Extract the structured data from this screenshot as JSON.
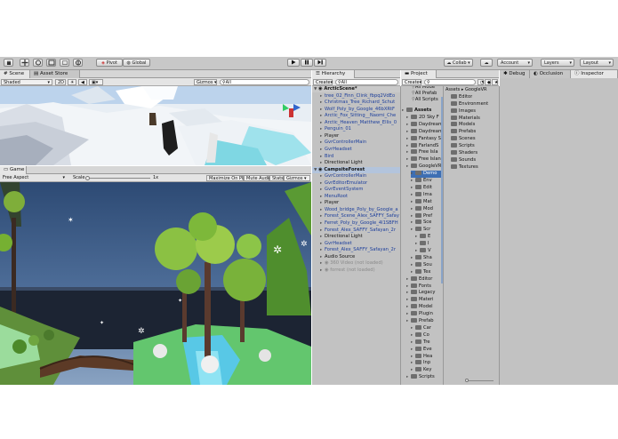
{
  "toolbar": {
    "pivot": "Pivot",
    "global": "Global",
    "collab": "Collab",
    "account": "Account",
    "layers": "Layers",
    "layout": "Layout"
  },
  "scene": {
    "tab": "Scene",
    "tab2": "Asset Store",
    "shading": "Shaded",
    "mode2d": "2D",
    "gizmos": "Gizmos",
    "search": "All"
  },
  "game": {
    "tab": "Game",
    "aspect": "Free Aspect",
    "scale_label": "Scale",
    "scale_value": "1x",
    "maximize": "Maximize On Play",
    "mute": "Mute Audio",
    "stats": "Stats",
    "gizmos": "Gizmos"
  },
  "hierarchy": {
    "tab": "Hierarchy",
    "create": "Create",
    "search": "All",
    "rows": [
      {
        "text": "ArcticScene*",
        "kind": "scene"
      },
      {
        "text": "tree_02_Finn_Clink_fbpq2VdEo",
        "kind": "blue"
      },
      {
        "text": "Christmas_Tree_Richard_Schut",
        "kind": "blue"
      },
      {
        "text": "Wolf_Poly_by_Google_46bXRtF",
        "kind": "blue"
      },
      {
        "text": "Arctic_Fox_Sitting__Naomi_Che",
        "kind": "blue"
      },
      {
        "text": "Arctic_Heaven_Matthew_Ellis_0",
        "kind": "blue"
      },
      {
        "text": "Penguin_01",
        "kind": "blue"
      },
      {
        "text": "Player",
        "kind": "normal"
      },
      {
        "text": "GvrControllerMain",
        "kind": "blue"
      },
      {
        "text": "GvrHeadset",
        "kind": "blue"
      },
      {
        "text": "Bird",
        "kind": "blue"
      },
      {
        "text": "Directional Light",
        "kind": "normal"
      },
      {
        "text": "CampsiteForest",
        "kind": "selected"
      },
      {
        "text": "GvrControllerMain",
        "kind": "blue"
      },
      {
        "text": "GvrEditorEmulator",
        "kind": "blue"
      },
      {
        "text": "GvrEventSystem",
        "kind": "blue"
      },
      {
        "text": "MenuRoot",
        "kind": "blue"
      },
      {
        "text": "Player",
        "kind": "normal"
      },
      {
        "text": "Wood_bridge_Poly_by_Google_a",
        "kind": "blue"
      },
      {
        "text": "Forest_Scene_Alex_SAFFY_Safay",
        "kind": "blue"
      },
      {
        "text": "Ferret_Poly_by_Google_4l1SBFH",
        "kind": "blue"
      },
      {
        "text": "Forest_Alex_SAFFY_Safayan_2r",
        "kind": "blue"
      },
      {
        "text": "Directional Light",
        "kind": "normal"
      },
      {
        "text": "GvrHeadset",
        "kind": "blue"
      },
      {
        "text": "Forest_Alex_SAFFY_Safayan_2r",
        "kind": "blue"
      },
      {
        "text": "Audio Source",
        "kind": "normal"
      },
      {
        "text": "360 Video (not loaded)",
        "kind": "grey"
      },
      {
        "text": "forrest (not loaded)",
        "kind": "grey"
      }
    ]
  },
  "project": {
    "tab": "Project",
    "create": "Create",
    "favorites": [
      "All Mode",
      "All Prefab",
      "All Scripts"
    ],
    "tree": [
      {
        "text": "Assets",
        "depth": 0
      },
      {
        "text": "2D Sky F",
        "depth": 1
      },
      {
        "text": "Daydream",
        "depth": 1
      },
      {
        "text": "Daydream",
        "depth": 1
      },
      {
        "text": "Fantasy S",
        "depth": 1
      },
      {
        "text": "FarlandS",
        "depth": 1
      },
      {
        "text": "Free Isla",
        "depth": 1
      },
      {
        "text": "Free Islan",
        "depth": 1
      },
      {
        "text": "GoogleVR",
        "depth": 1
      },
      {
        "text": "Demo",
        "depth": 2
      },
      {
        "text": "Env",
        "depth": 2
      },
      {
        "text": "Edit",
        "depth": 2
      },
      {
        "text": "Ima",
        "depth": 2
      },
      {
        "text": "Mat",
        "depth": 2
      },
      {
        "text": "Mod",
        "depth": 2
      },
      {
        "text": "Pref",
        "depth": 2
      },
      {
        "text": "Sce",
        "depth": 2
      },
      {
        "text": "Scr",
        "depth": 2
      },
      {
        "text": "E",
        "depth": 3
      },
      {
        "text": "I",
        "depth": 3
      },
      {
        "text": "V",
        "depth": 3
      },
      {
        "text": "Sha",
        "depth": 2
      },
      {
        "text": "Sou",
        "depth": 2
      },
      {
        "text": "Tex",
        "depth": 2
      },
      {
        "text": "Editor",
        "depth": 1
      },
      {
        "text": "Fonts",
        "depth": 1
      },
      {
        "text": "Legacy",
        "depth": 1
      },
      {
        "text": "Materi",
        "depth": 1
      },
      {
        "text": "Model",
        "depth": 1
      },
      {
        "text": "Plugin",
        "depth": 1
      },
      {
        "text": "Prefab",
        "depth": 1
      },
      {
        "text": "Car",
        "depth": 2
      },
      {
        "text": "Co",
        "depth": 2
      },
      {
        "text": "Tre",
        "depth": 2
      },
      {
        "text": "Eve",
        "depth": 2
      },
      {
        "text": "Hea",
        "depth": 2
      },
      {
        "text": "Inp",
        "depth": 2
      },
      {
        "text": "Key",
        "depth": 2
      },
      {
        "text": "Scripts",
        "depth": 1
      }
    ],
    "breadcrumb": [
      "Assets",
      "GoogleVR"
    ],
    "folders": [
      "Editor",
      "Environment",
      "Images",
      "Materials",
      "Models",
      "Prefabs",
      "Scenes",
      "Scripts",
      "Shaders",
      "Sounds",
      "Textures"
    ]
  },
  "right": {
    "debug": "Debug",
    "occlusion": "Occlusion",
    "inspector": "Inspector"
  },
  "colors": {
    "toolbar": "#c8c8c8",
    "panel": "#c2c2c2",
    "selection": "#3e6fb3",
    "blue_text": "#1d3f9c"
  }
}
